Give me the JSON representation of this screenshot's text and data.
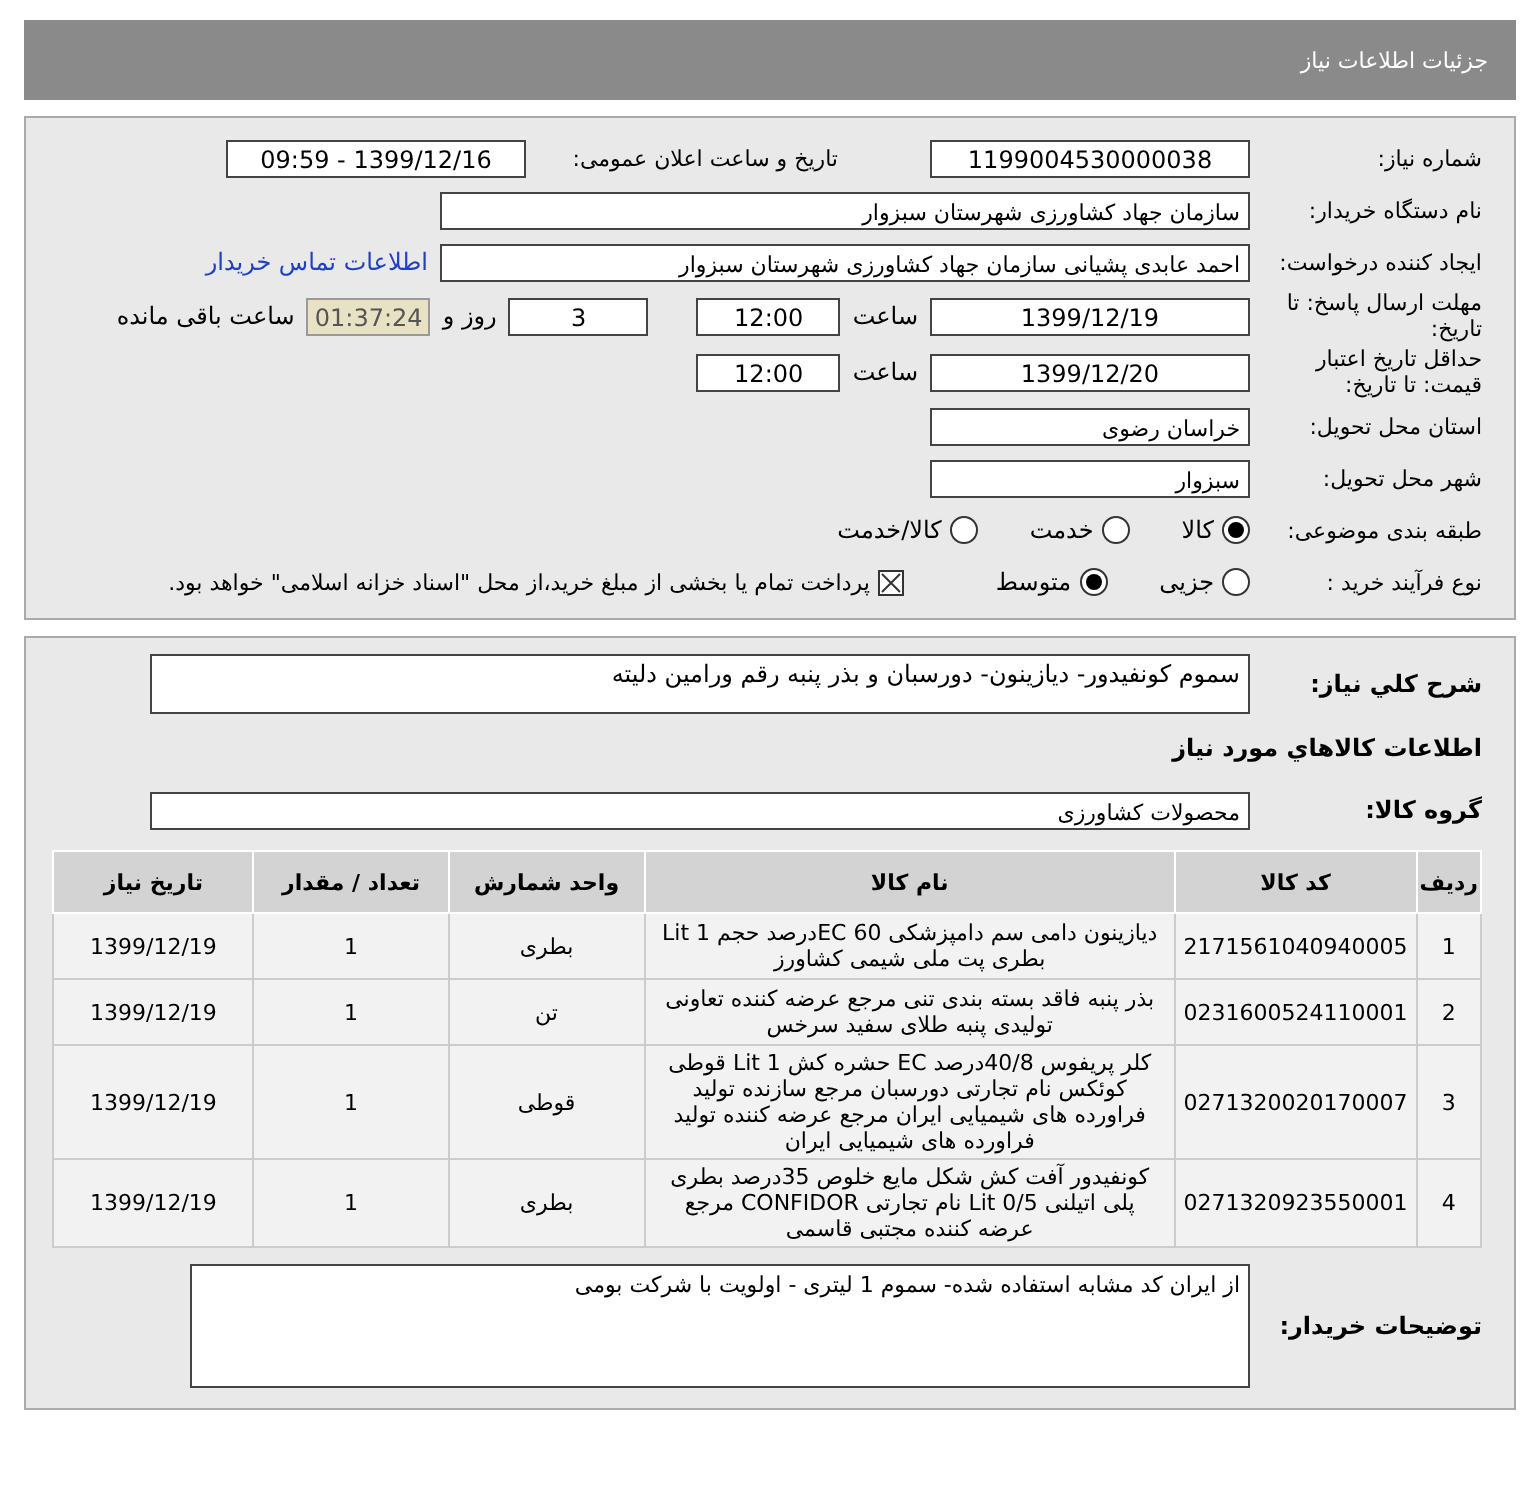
{
  "header": {
    "title": "جزئیات اطلاعات نیاز"
  },
  "need_number": {
    "label": "شماره نیاز:",
    "value": "1199004530000038"
  },
  "announce_datetime": {
    "label": "تاریخ و ساعت اعلان عمومی:",
    "value": "1399/12/16 - 09:59"
  },
  "buyer_org": {
    "label": "نام دستگاه خریدار:",
    "value": "سازمان جهاد کشاورزی شهرستان سبزوار"
  },
  "requester": {
    "label": "ایجاد کننده درخواست:",
    "value": "احمد عابدی پشیانی سازمان جهاد کشاورزی شهرستان سبزوار",
    "link": "اطلاعات تماس خریدار"
  },
  "reply_deadline": {
    "label": "مهلت ارسال پاسخ: تا تاریخ:",
    "date": "1399/12/19",
    "time_label": "ساعت",
    "time": "12:00",
    "days": "3",
    "days_label": "روز و",
    "remaining": "01:37:24",
    "remaining_label": "ساعت باقی مانده"
  },
  "price_validity": {
    "label": "حداقل تاریخ اعتبار قیمت: تا تاریخ:",
    "date": "1399/12/20",
    "time_label": "ساعت",
    "time": "12:00"
  },
  "delivery_province": {
    "label": "استان محل تحویل:",
    "value": "خراسان رضوی"
  },
  "delivery_city": {
    "label": "شهر محل تحویل:",
    "value": "سبزوار"
  },
  "subject_category": {
    "label": "طبقه بندی موضوعی:",
    "options": [
      {
        "label": "کالا",
        "selected": true
      },
      {
        "label": "خدمت",
        "selected": false
      },
      {
        "label": "کالا/خدمت",
        "selected": false
      }
    ]
  },
  "purchase_process": {
    "label": "نوع فرآیند خرید :",
    "options": [
      {
        "label": "جزیی",
        "selected": false
      },
      {
        "label": "متوسط",
        "selected": true
      }
    ],
    "payment": {
      "label": "پرداخت تمام یا بخشی از مبلغ خرید،از محل \"اسناد خزانه اسلامی\" خواهد بود.",
      "checked": true
    }
  },
  "general_description": {
    "label": "شرح کلي نياز:",
    "value": "سموم کونفیدور- دیازینون- دورسبان و بذر پنبه رقم ورامین دلیته"
  },
  "goods_section": {
    "title": "اطلاعات کالاهاي مورد نياز"
  },
  "goods_group": {
    "label": "گروه کالا:",
    "value": "محصولات کشاورزی"
  },
  "table": {
    "columns": [
      "ردیف",
      "کد کالا",
      "نام کالا",
      "واحد شمارش",
      "تعداد / مقدار",
      "تاریخ نیاز"
    ],
    "rows": [
      [
        "1",
        "2171561040940005",
        "دیازینون دامی سم دامپزشکی EC 60درصد حجم Lit 1 بطری پت ملی شیمی کشاورز",
        "بطری",
        "1",
        "1399/12/19"
      ],
      [
        "2",
        "0231600524110001",
        "بذر پنبه فاقد بسته بندی تنی مرجع عرضه کننده تعاونی تولیدی پنبه طلای سفید سرخس",
        "تن",
        "1",
        "1399/12/19"
      ],
      [
        "3",
        "0271320020170007",
        "کلر پریفوس 40/8درصد EC حشره کش Lit 1 قوطی کوئکس نام تجارتی دورسبان مرجع سازنده تولید فراورده های شیمیایی ایران مرجع عرضه کننده تولید فراورده های شیمیایی ایران",
        "قوطی",
        "1",
        "1399/12/19"
      ],
      [
        "4",
        "0271320923550001",
        "کونفیدور آفت کش شکل مایع خلوص 35درصد بطری پلی اتیلنی Lit 0/5 نام تجارتی CONFIDOR مرجع عرضه کننده مجتبی قاسمی",
        "بطری",
        "1",
        "1399/12/19"
      ]
    ]
  },
  "buyer_notes": {
    "label": "توضیحات خریدار:",
    "value": "از ایران کد مشابه استفاده شده- سموم 1 لیتری - اولویت با شرکت بومی"
  }
}
